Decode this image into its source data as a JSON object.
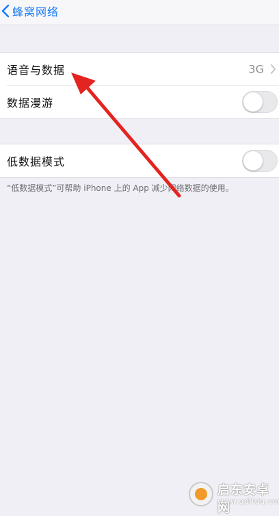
{
  "nav": {
    "back_label": "蜂窝网络"
  },
  "section1": {
    "voice_data": {
      "label": "语音与数据",
      "value": "3G"
    },
    "data_roaming": {
      "label": "数据漫游",
      "toggle_on": false
    }
  },
  "section2": {
    "low_data_mode": {
      "label": "低数据模式",
      "toggle_on": false
    },
    "footer": "“低数据模式”可帮助 iPhone 上的 App 减少网络数据的使用。"
  },
  "watermark": {
    "title": "启东安卓网",
    "url": "www.qdltdq.com"
  },
  "colors": {
    "accent": "#1a7cf5",
    "annotation_arrow": "#e32420",
    "background": "#f0eff5"
  }
}
